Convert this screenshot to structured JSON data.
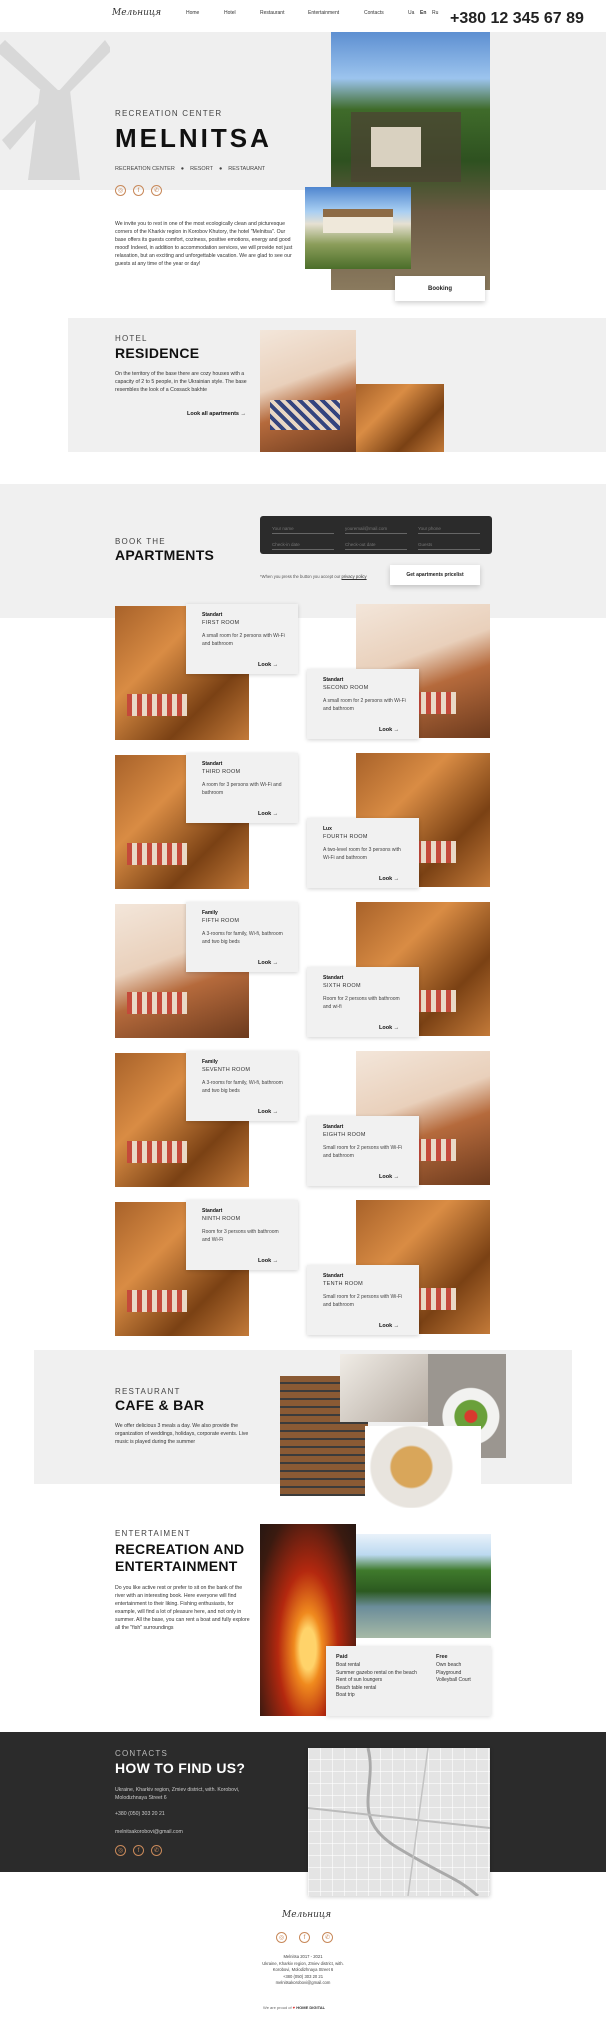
{
  "brand": {
    "logo": "Мельниця"
  },
  "nav": {
    "items": [
      "Home",
      "Hotel",
      "Restaurant",
      "Entertainment",
      "Contacts"
    ],
    "langs": [
      "Ua",
      "En",
      "Ru"
    ],
    "phone": "+380 12 345 67 89"
  },
  "hero": {
    "kicker": "RECREATION CENTER",
    "title": "MELNITSA",
    "tags": [
      "RECREATION CENTER",
      "RESORT",
      "RESTAURANT"
    ],
    "text": "We invite you to rest in one of the most ecologically clean and picturesque corners of the Kharkiv region in Korobov Khutory, the hotel \"Melnitsa\". Our base offers its guests comfort, coziness, positive emotions, energy and good mood! Indeed, in addition to accommodation services, we will provide not just relaxation, but an exciting and unforgettable vacation. We are glad to see our guests at any time of the year or day!",
    "booking": "Booking"
  },
  "residence": {
    "kicker": "HOTEL",
    "title": "RESIDENCE",
    "text": "On the territory of the base there are cozy houses with a capacity of 2 to 5 people, in the Ukrainian style. The base resembles the look of a Cossack bakhte",
    "link": "Look all apartments"
  },
  "book": {
    "kicker": "BOOK THE",
    "title": "APARTMENTS",
    "name": "Your name",
    "email": "youremail@mail.com",
    "phone": "Your phone",
    "checkin": "Check-in date",
    "checkout": "Check-out date",
    "guests": "Guests",
    "note": "*When you press the button you accept our",
    "privacy": "privacy policy",
    "btn": "Get apartments pricelist"
  },
  "rooms": [
    {
      "cat": "Standart",
      "name": "FIRST ROOM",
      "desc": "A small room for 2 persons with Wi-Fi and bathroom",
      "look": "Look"
    },
    {
      "cat": "Standart",
      "name": "SECOND ROOM",
      "desc": "A small room for 2 persons with Wi-Fi and bathroom",
      "look": "Look"
    },
    {
      "cat": "Standart",
      "name": "THIRD ROOM",
      "desc": "A room for 3 persons with Wi-Fi and bathroom",
      "look": "Look"
    },
    {
      "cat": "Lux",
      "name": "FOURTH ROOM",
      "desc": "A two-level room for 3 persons with Wi-Fi and bathroom",
      "look": "Look"
    },
    {
      "cat": "Family",
      "name": "FIFTH ROOM",
      "desc": "A 3-rooms for family, Wi-fi, bathroom and two big beds",
      "look": "Look"
    },
    {
      "cat": "Standart",
      "name": "SIXTH ROOM",
      "desc": "Room for 2 persons with bathroom and wi-fi",
      "look": "Look"
    },
    {
      "cat": "Family",
      "name": "SEVENTH ROOM",
      "desc": "A 3-rooms for family, Wi-fi, bathroom and two big beds",
      "look": "Look"
    },
    {
      "cat": "Standart",
      "name": "EIGHTH ROOM",
      "desc": "Small room for 2 persons with Wi-Fi and bathroom",
      "look": "Look"
    },
    {
      "cat": "Standart",
      "name": "NINTH ROOM",
      "desc": "Room for 3 persons with bathroom and Wi-Fi",
      "look": "Look"
    },
    {
      "cat": "Standart",
      "name": "TENTH ROOM",
      "desc": "Small room for 2 persons with Wi-Fi and bathroom",
      "look": "Look"
    }
  ],
  "cafe": {
    "kicker": "RESTAURANT",
    "title": "CAFE & BAR",
    "text": "We offer delicious 3 meals a day. We also provide the organization of weddings, holidays, corporate events. Live music is played during the summer"
  },
  "ent": {
    "kicker": "ENTERTAIMENT",
    "title1": "RECREATION AND",
    "title2": "ENTERTAINMENT",
    "text": "Do you like active rest or prefer to sit on the bank of the river with an interesting book. Here everyone will find entertainment to their liking. Fishing enthusiasts, for example, will find a lot of pleasure here, and not only in summer. All the base, you can rent a boat and fully explore all the \"fish\" surroundings",
    "paid_title": "Paid",
    "paid": [
      "Boat rental",
      "Summer gazebo rental on the beach",
      "Rent of sun loungers",
      "Beach table rental",
      "Boat trip"
    ],
    "free_title": "Free",
    "free": [
      "Own beach",
      "Playground",
      "Volleyball Court"
    ]
  },
  "contacts": {
    "kicker": "CONTACTS",
    "title": "HOW TO FIND US?",
    "address": "Ukraine, Kharkiv region, Zmiev district, with. Korobovi, Molodizhnaya Street 6",
    "phone": "+380 (050) 303 20 21",
    "email": "melnitsakorobovi@gmail.com"
  },
  "footer": {
    "copy": "Melnitsa 2017 - 2021",
    "address": "Ukraine, Kharkiv region, Zmiev district, with. Korobovi, Molodizhnaya Street 6",
    "phone": "+380 (050) 303 20 21",
    "email": "melnitsakorobovi@gmail.com",
    "made": "We are proud of",
    "by": "HOME DIGITAL"
  },
  "colors": {
    "accent": "#c8895a",
    "dark": "#2b2b2b",
    "light": "#f0f0f0"
  }
}
